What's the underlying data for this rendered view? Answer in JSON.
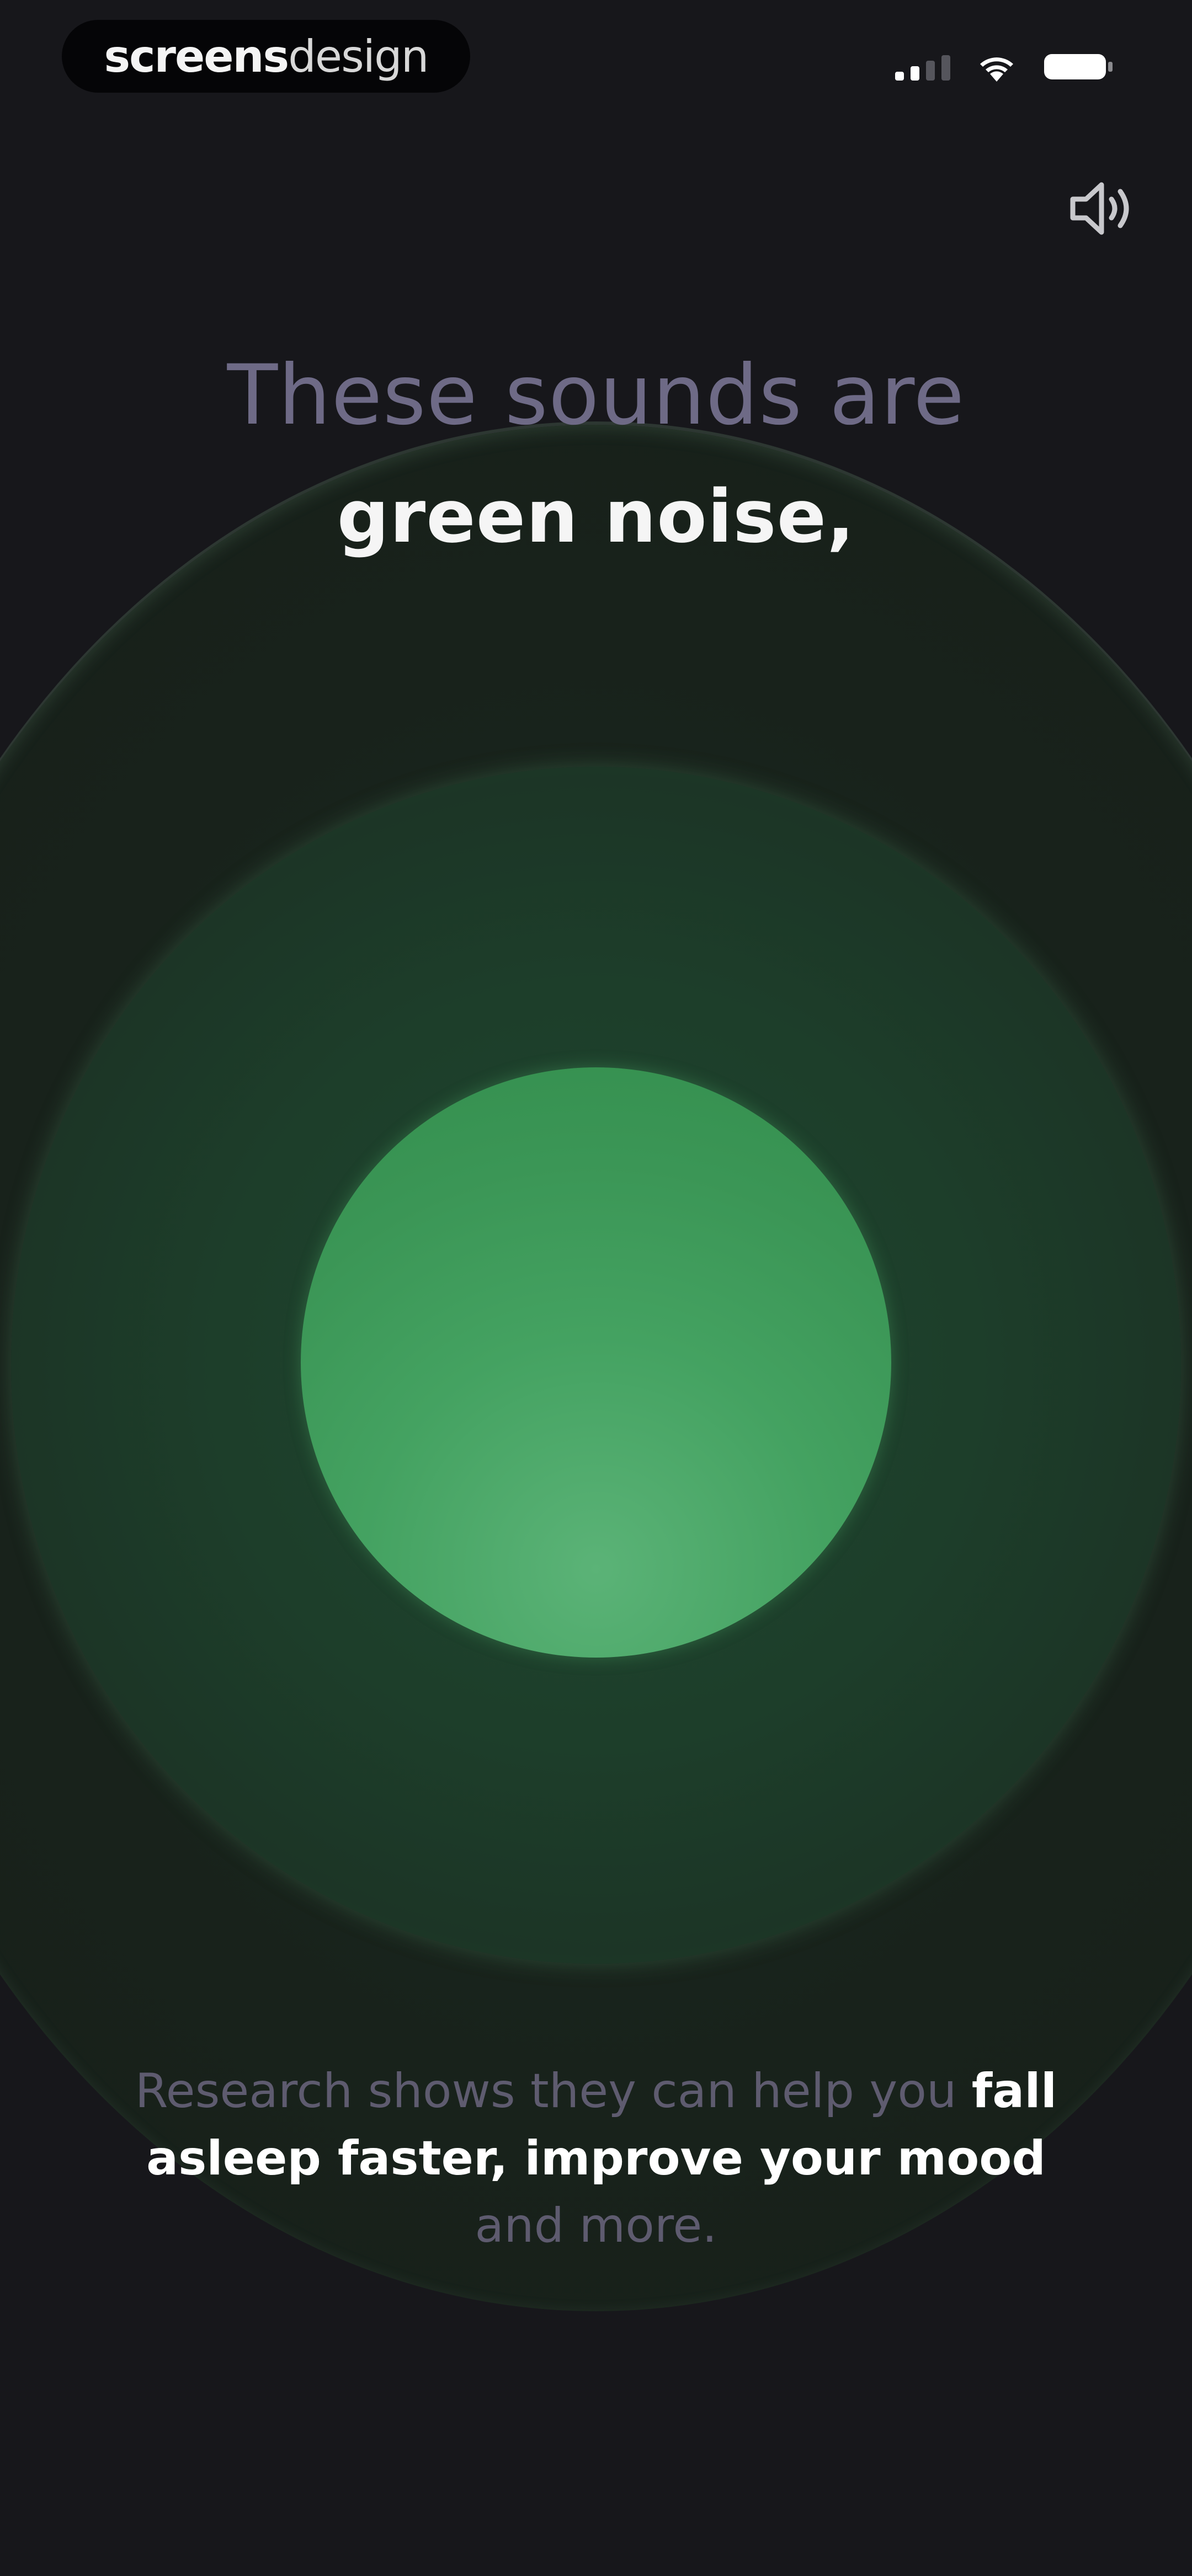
{
  "watermark": {
    "bold": "screens",
    "light": "design"
  },
  "status_bar": {
    "signal_icon": "cellular-signal-icon",
    "wifi_icon": "wifi-icon",
    "battery_icon": "battery-icon"
  },
  "sound_button": {
    "icon": "speaker-icon"
  },
  "headline": {
    "pre": "These sounds are",
    "main": "green noise,"
  },
  "body": {
    "part1": "Research shows they can help you ",
    "highlight": "fall asleep faster, improve your mood",
    "part2": " and more."
  },
  "colors": {
    "background": "#17171b",
    "accent_green": "#44a261",
    "headline_muted": "#6e6a86",
    "body_muted": "#5e5b6f"
  }
}
